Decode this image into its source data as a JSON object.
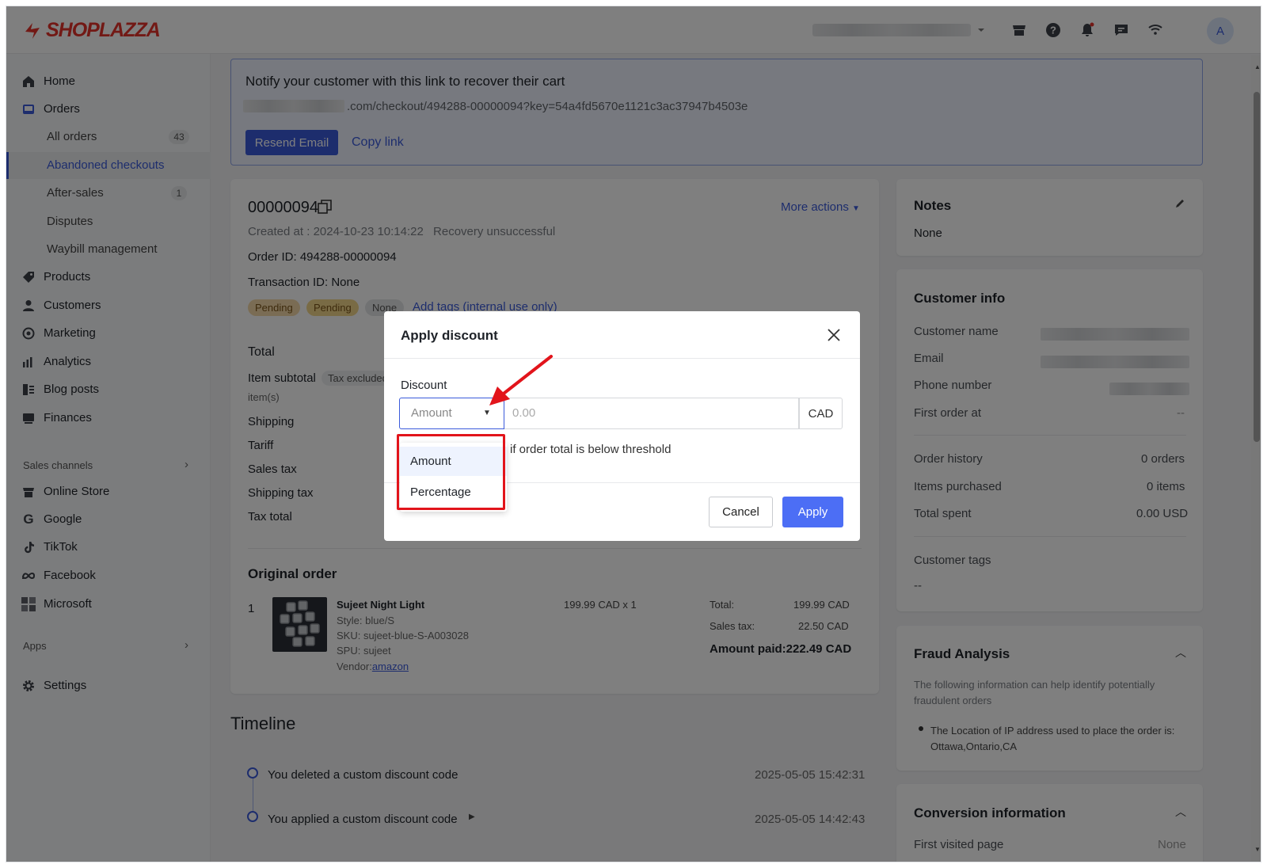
{
  "brand": {
    "name": "SHOPLAZZA"
  },
  "header": {
    "avatar_initial": "A"
  },
  "sidebar": {
    "home": "Home",
    "orders": "Orders",
    "all_orders": "All orders",
    "all_orders_count": "43",
    "abandoned": "Abandoned checkouts",
    "after_sales": "After-sales",
    "after_sales_count": "1",
    "disputes": "Disputes",
    "waybill": "Waybill management",
    "products": "Products",
    "customers": "Customers",
    "marketing": "Marketing",
    "analytics": "Analytics",
    "blog_posts": "Blog posts",
    "finances": "Finances",
    "sales_channels": "Sales channels",
    "online_store": "Online Store",
    "google": "Google",
    "tiktok": "TikTok",
    "facebook": "Facebook",
    "microsoft": "Microsoft",
    "apps": "Apps",
    "settings": "Settings"
  },
  "notify": {
    "title": "Notify your customer with this link to recover their cart",
    "link": ".com/checkout/494288-00000094?key=54a4fd5670e1121c3ac37947b4503e",
    "resend": "Resend Email",
    "copy": "Copy link"
  },
  "order": {
    "number": "00000094",
    "more_actions": "More actions",
    "created_label": "Created at :",
    "created_value": "2024-10-23 10:14:22",
    "recovery": "Recovery unsuccessful",
    "order_id": "Order ID: 494288-00000094",
    "transaction_id": "Transaction ID: None",
    "tags": [
      "Pending",
      "Pending",
      "None"
    ],
    "add_tags": "Add tags (internal use only)",
    "total_title": "Total",
    "item_subtotal": "Item subtotal",
    "tax_excluded": "Tax excluded",
    "items": "item(s)",
    "shipping": "Shipping",
    "tariff": "Tariff",
    "sales_tax": "Sales tax",
    "shipping_tax": "Shipping tax",
    "tax_total": "Tax total",
    "original_order": "Original order",
    "line": {
      "index": "1",
      "name": "Sujeet Night Light",
      "style": "Style: blue/S",
      "sku": "SKU: sujeet-blue-S-A003028",
      "spu": "SPU: sujeet",
      "vendor_label": "Vendor:",
      "vendor": "amazon",
      "qty_price": "199.99 CAD x 1",
      "total_label": "Total:",
      "total_value": "199.99 CAD",
      "sales_tax_label": "Sales tax:",
      "sales_tax_value": "22.50 CAD",
      "amount_paid": "Amount paid:222.49 CAD"
    }
  },
  "timeline": {
    "title": "Timeline",
    "events": [
      {
        "text": "You deleted a custom discount code",
        "time": "2025-05-05 15:42:31"
      },
      {
        "text": "You applied a custom discount code",
        "time": "2025-05-05 14:42:43"
      }
    ]
  },
  "notes": {
    "title": "Notes",
    "value": "None"
  },
  "customer": {
    "title": "Customer info",
    "name_label": "Customer name",
    "email_label": "Email",
    "phone_label": "Phone number",
    "first_order_label": "First order at",
    "first_order_value": "--",
    "order_history_label": "Order history",
    "order_history_value": "0 orders",
    "items_label": "Items purchased",
    "items_value": "0 items",
    "spent_label": "Total spent",
    "spent_value": "0.00 USD",
    "tags_label": "Customer tags",
    "tags_value": "--"
  },
  "fraud": {
    "title": "Fraud Analysis",
    "desc": "The following information can help identify potentially fraudulent orders",
    "bullet": "The Location of IP address used to place the order is: Ottawa,Ontario,CA"
  },
  "conversion": {
    "title": "Conversion information",
    "first_page": "First visited page",
    "first_page_value": "None"
  },
  "modal": {
    "title": "Apply discount",
    "discount_label": "Discount",
    "type_value": "Amount",
    "amount_placeholder": "0.00",
    "currency": "CAD",
    "threshold_text": "if order total is below threshold",
    "cancel": "Cancel",
    "apply": "Apply",
    "options": [
      "Amount",
      "Percentage"
    ]
  },
  "colors": {
    "accent": "#3b5bdb",
    "brand": "#e5322b",
    "highlight": "#e2141b",
    "pending_tag": "#f5d9a8"
  }
}
